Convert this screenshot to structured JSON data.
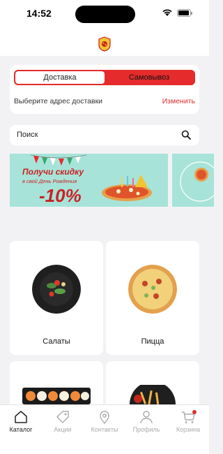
{
  "status_bar": {
    "time": "14:52"
  },
  "delivery": {
    "tab_delivery": "Доставка",
    "tab_pickup": "Самовывоз",
    "address_prompt": "Выберите адрес доставки",
    "change_label": "Изменить"
  },
  "search": {
    "placeholder": "Поиск"
  },
  "banner": {
    "headline": "Получи скидку",
    "subline": "в свой День Рождения",
    "discount": "-10%"
  },
  "categories": [
    {
      "label": "Салаты"
    },
    {
      "label": "Пицца"
    },
    {
      "label": ""
    },
    {
      "label": ""
    }
  ],
  "tabbar": {
    "items": [
      {
        "label": "Каталог",
        "icon": "home-icon",
        "active": true
      },
      {
        "label": "Акции",
        "icon": "tag-icon",
        "active": false
      },
      {
        "label": "Контакты",
        "icon": "location-pin-icon",
        "active": false
      },
      {
        "label": "Профиль",
        "icon": "user-icon",
        "active": false
      },
      {
        "label": "Корзина",
        "icon": "cart-icon",
        "active": false
      }
    ]
  },
  "colors": {
    "accent": "#e52b2b",
    "banner_bg": "#a8e3d9",
    "page_bg": "#f2f2f4"
  }
}
